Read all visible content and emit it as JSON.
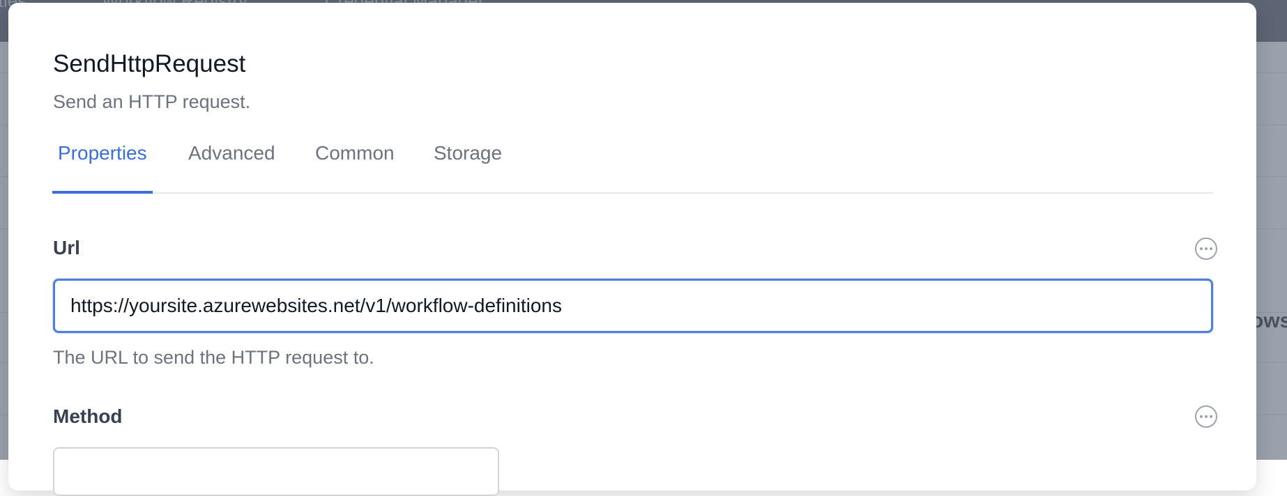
{
  "background": {
    "nav_ghost_items": [
      "ities",
      "Workflow Registry",
      "Credential Manager"
    ],
    "side_text": "ows"
  },
  "dialog": {
    "title": "SendHttpRequest",
    "subtitle": "Send an HTTP request.",
    "tabs": [
      {
        "label": "Properties",
        "active": true
      },
      {
        "label": "Advanced",
        "active": false
      },
      {
        "label": "Common",
        "active": false
      },
      {
        "label": "Storage",
        "active": false
      }
    ],
    "fields": {
      "url": {
        "label": "Url",
        "value": "https://yoursite.azurewebsites.net/v1/workflow-definitions",
        "help": "The URL to send the HTTP request to."
      },
      "method": {
        "label": "Method",
        "value": ""
      }
    }
  },
  "colors": {
    "accent": "#3b6fd8",
    "overlay": "#9aa1ac",
    "title_text": "#111827",
    "muted_text": "#6b7280"
  },
  "icons": {
    "field_menu": "more-horizontal-circle-icon"
  }
}
